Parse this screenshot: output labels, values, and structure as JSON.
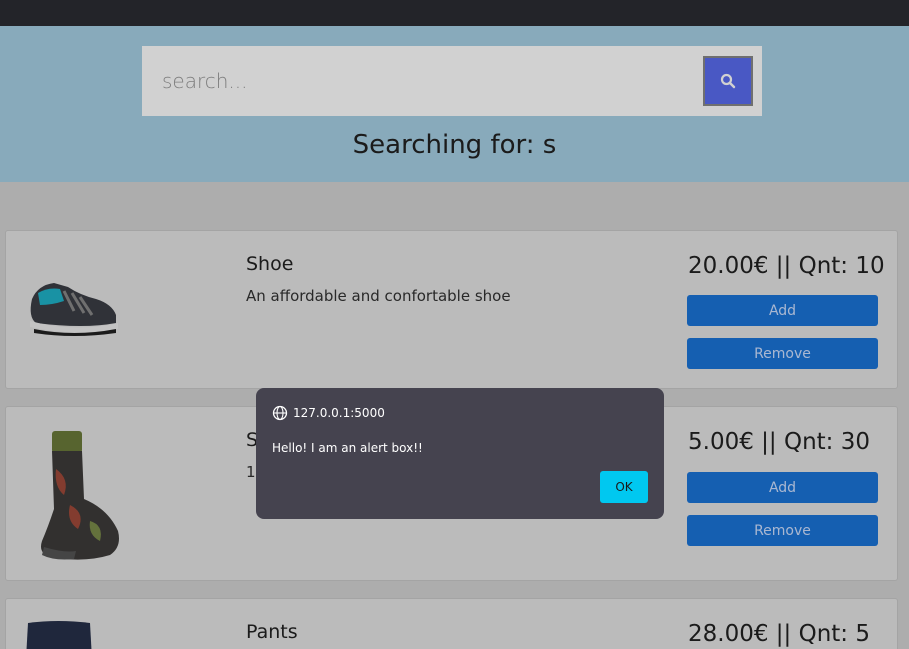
{
  "search": {
    "placeholder": "search...",
    "button_icon": "search-icon",
    "status": "Searching for: s"
  },
  "products": [
    {
      "name": "Shoe",
      "description": "An affordable and confortable shoe",
      "price_qty": "20.00€ || Qnt: 10",
      "image_icon": "shoe-image"
    },
    {
      "name": "S",
      "description": "1",
      "price_qty": "5.00€ || Qnt: 30",
      "image_icon": "sock-image"
    },
    {
      "name": "Pants",
      "description": "",
      "price_qty": "28.00€ || Qnt: 5",
      "image_icon": "pants-image"
    }
  ],
  "buttons": {
    "add": "Add",
    "remove": "Remove"
  },
  "alert": {
    "origin": "127.0.0.1:5000",
    "message": "Hello! I am an alert box!!",
    "ok_label": "OK"
  },
  "colors": {
    "topbar": "#2b2d33",
    "hero": "#a7d0e4",
    "search_button": "#5a6cf0",
    "action_button": "#1a74d8",
    "alert_bg": "#45434f",
    "ok_button": "#00c8f0"
  }
}
